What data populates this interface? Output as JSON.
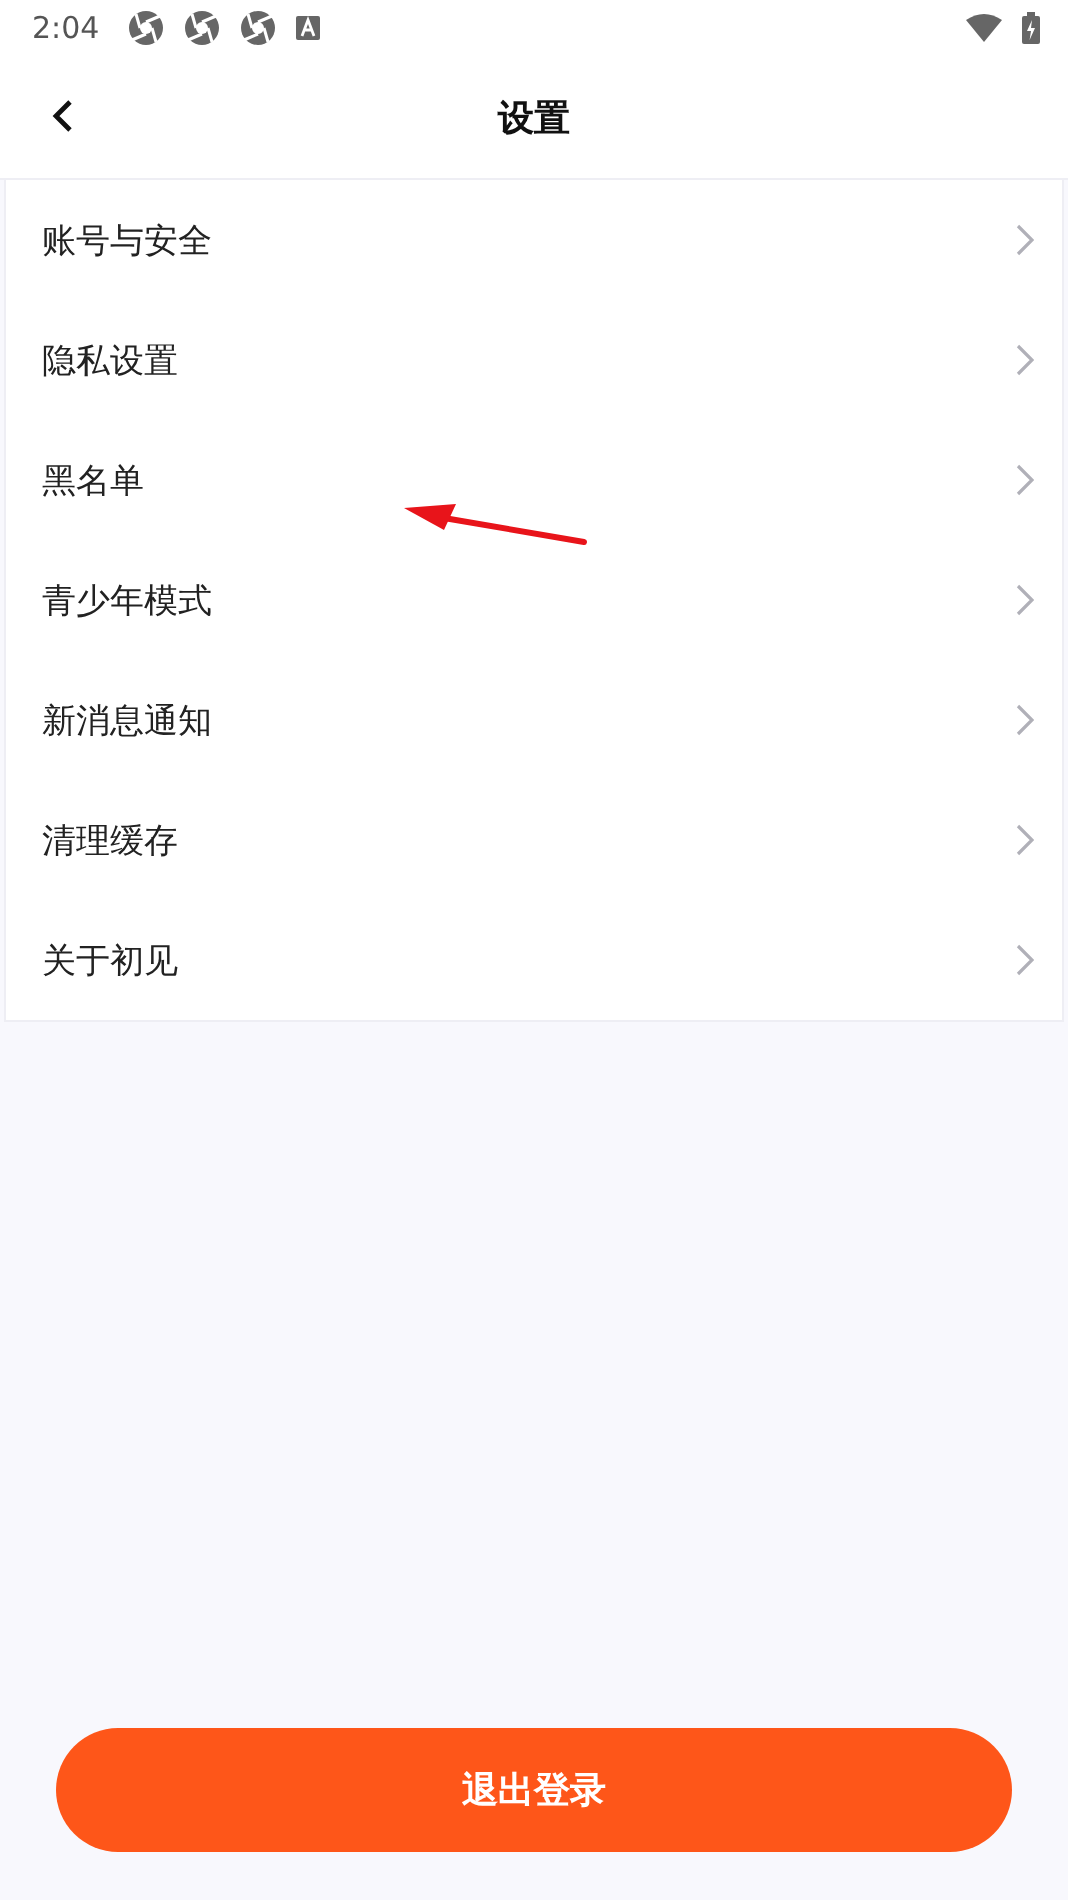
{
  "status_bar": {
    "time": "2:04"
  },
  "header": {
    "title": "设置"
  },
  "menu_items": [
    {
      "label": "账号与安全"
    },
    {
      "label": "隐私设置"
    },
    {
      "label": "黑名单"
    },
    {
      "label": "青少年模式"
    },
    {
      "label": "新消息通知"
    },
    {
      "label": "清理缓存"
    },
    {
      "label": "关于初见"
    }
  ],
  "annotation": {
    "kind": "arrow",
    "color": "#e8141a"
  },
  "logout_button": {
    "label": "退出登录"
  }
}
